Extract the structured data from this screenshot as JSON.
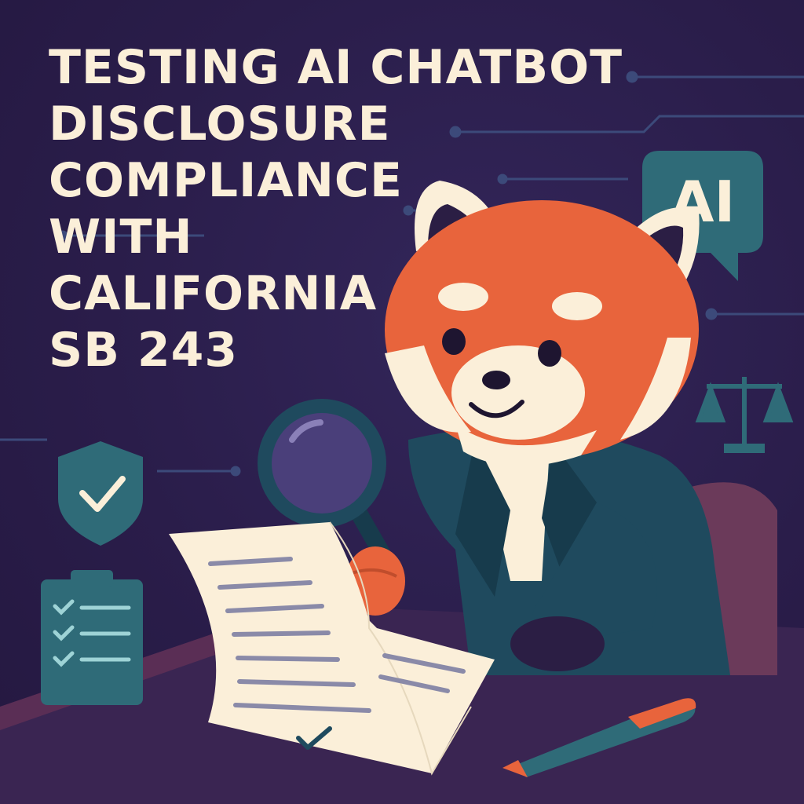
{
  "headline": {
    "lines": [
      "TESTING AI CHATBOT",
      "DISCLOSURE",
      "COMPLIANCE",
      "WITH",
      "CALIFORNIA",
      "SB 243"
    ]
  },
  "badge": {
    "text": "AI"
  },
  "icons": [
    "circuit-lines",
    "ai-speech-bubble-icon",
    "scales-of-justice-icon",
    "shield-check-icon",
    "checklist-clipboard-icon",
    "magnifying-glass-icon",
    "document-icon",
    "pen-icon"
  ],
  "colors": {
    "background": "#2a1d4a",
    "title": "#fbefd9",
    "panda_fur": "#e8643c",
    "cream": "#fbefd9",
    "teal": "#2f6b78",
    "suit": "#1f4a5e",
    "desk": "#3a2552",
    "chair": "#6b3a5a"
  }
}
